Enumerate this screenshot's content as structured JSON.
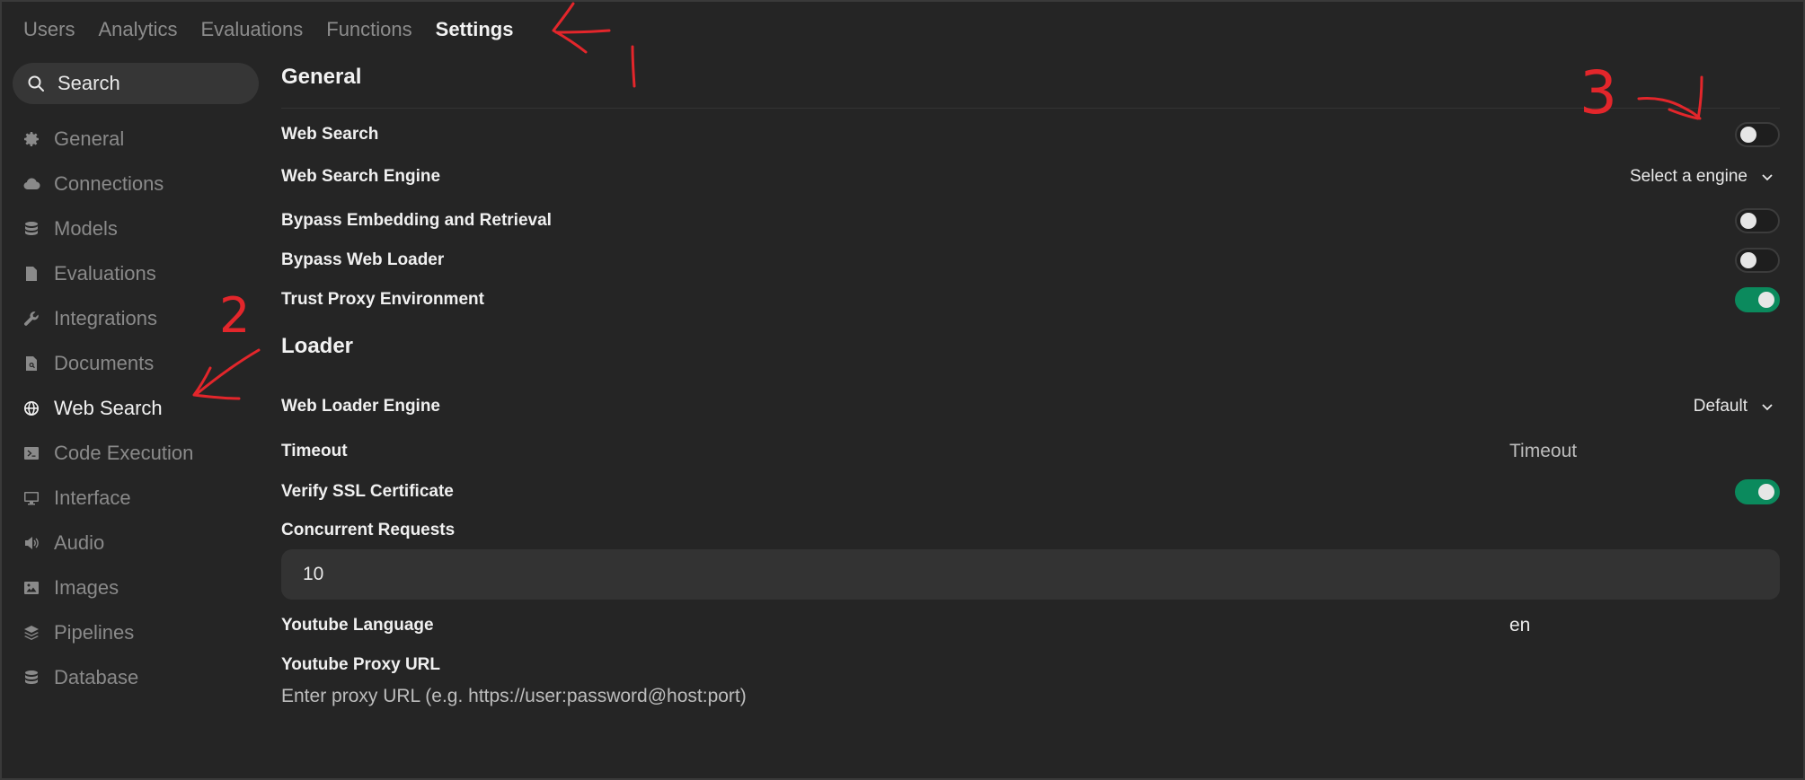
{
  "tabs": [
    "Users",
    "Analytics",
    "Evaluations",
    "Functions",
    "Settings"
  ],
  "search": {
    "label": "Search"
  },
  "sidebar": {
    "items": [
      {
        "label": "General",
        "icon": "gear-icon"
      },
      {
        "label": "Connections",
        "icon": "cloud-icon"
      },
      {
        "label": "Models",
        "icon": "database-icon"
      },
      {
        "label": "Evaluations",
        "icon": "document-chart-icon"
      },
      {
        "label": "Integrations",
        "icon": "wrench-icon"
      },
      {
        "label": "Documents",
        "icon": "document-search-icon"
      },
      {
        "label": "Web Search",
        "icon": "globe-icon"
      },
      {
        "label": "Code Execution",
        "icon": "terminal-icon"
      },
      {
        "label": "Interface",
        "icon": "monitor-icon"
      },
      {
        "label": "Audio",
        "icon": "speaker-icon"
      },
      {
        "label": "Images",
        "icon": "image-icon"
      },
      {
        "label": "Pipelines",
        "icon": "layers-icon"
      },
      {
        "label": "Database",
        "icon": "database-icon"
      }
    ],
    "active": "Web Search"
  },
  "general": {
    "title": "General",
    "web_search": "Web Search",
    "web_search_on": false,
    "engine_label": "Web Search Engine",
    "engine_value": "Select a engine",
    "bypass_embedding": "Bypass Embedding and Retrieval",
    "bypass_embedding_on": false,
    "bypass_loader": "Bypass Web Loader",
    "bypass_loader_on": false,
    "trust_proxy": "Trust Proxy Environment",
    "trust_proxy_on": true
  },
  "loader": {
    "title": "Loader",
    "engine_label": "Web Loader Engine",
    "engine_value": "Default",
    "timeout_label": "Timeout",
    "timeout_placeholder": "Timeout",
    "ssl_label": "Verify SSL Certificate",
    "ssl_on": true,
    "concurrent_label": "Concurrent Requests",
    "concurrent_value": "10",
    "yt_lang_label": "Youtube Language",
    "yt_lang_value": "en",
    "yt_proxy_label": "Youtube Proxy URL",
    "yt_proxy_placeholder": "Enter proxy URL (e.g. https://user:password@host:port)"
  },
  "annotations": {
    "one": "1",
    "two": "2",
    "three": "3",
    "color": "#e3262b"
  },
  "colors": {
    "accent": "#0b8a5d",
    "background": "#252525"
  }
}
